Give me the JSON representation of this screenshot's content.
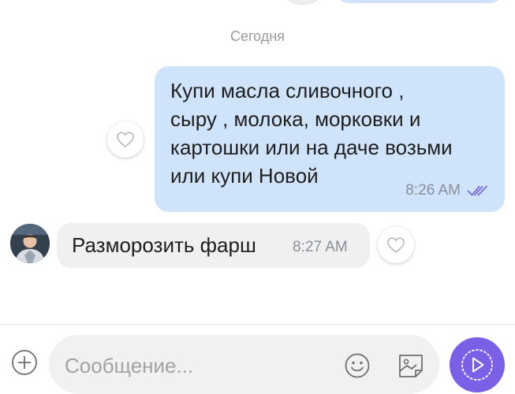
{
  "chat": {
    "date_separator": "Сегодня",
    "outgoing": {
      "text": "Купи масла сливочного ,\nсыру , молока, морковки  и\nкартошки или на даче возьми\nили купи Новой",
      "time": "8:26 AM",
      "status_icon": "double-check-icon"
    },
    "incoming": {
      "text": "Разморозить фарш",
      "time": "8:27 AM"
    }
  },
  "composer": {
    "placeholder": "Сообщение...",
    "icons": [
      "add-icon",
      "emoji-icon",
      "sticker-icon",
      "send-icon"
    ]
  },
  "colors": {
    "outgoing_bubble": "#cfe4fb",
    "incoming_bubble": "#f0f0f0",
    "accent": "#7b5fe6",
    "read_check": "#7b6cd9"
  }
}
